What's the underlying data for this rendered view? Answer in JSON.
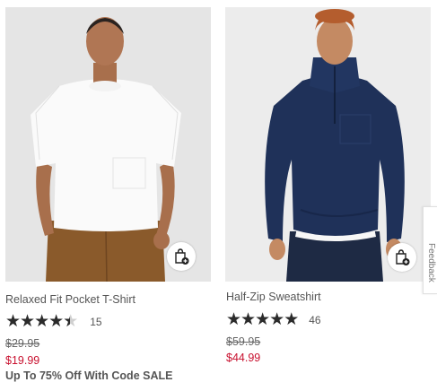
{
  "products": [
    {
      "name": "Relaxed Fit Pocket T-Shirt",
      "rating_stars": 4.5,
      "rating_out_of": 5,
      "review_count": "15",
      "original_price": "$29.95",
      "sale_price": "$19.99",
      "promo": "Up To 75% Off With Code SALE",
      "image_icon": "model-white-tshirt-khaki-pants",
      "quick_add_icon": "shopping-bag-plus-icon"
    },
    {
      "name": "Half-Zip Sweatshirt",
      "rating_stars": 5,
      "rating_out_of": 5,
      "review_count": "46",
      "original_price": "$59.95",
      "sale_price": "$44.99",
      "image_icon": "model-navy-half-zip-sweatshirt",
      "quick_add_icon": "shopping-bag-plus-icon"
    }
  ],
  "feedback_tab": {
    "label": "Feedback"
  },
  "colors": {
    "sale_red": "#c8102e",
    "star_fill": "#2b2b2b",
    "star_empty": "#d0d0d0",
    "text_gray": "#555555"
  }
}
